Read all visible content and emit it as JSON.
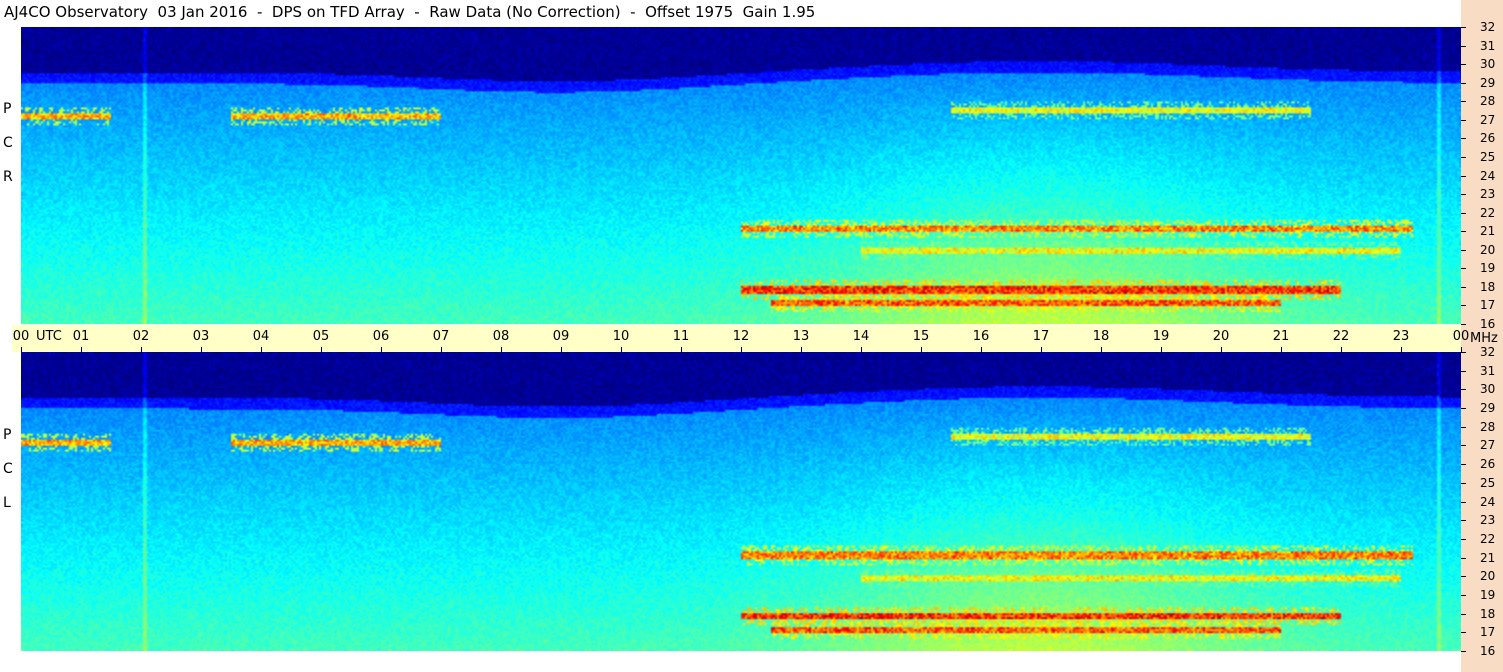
{
  "header": {
    "title": "AJ4CO Observatory  03 Jan 2016  -  DPS on TFD Array  -  Raw Data (No Correction)  -  Offset 1975  Gain 1.95"
  },
  "panels": [
    {
      "id": "rcp",
      "letters": [
        "R",
        "C",
        "P"
      ]
    },
    {
      "id": "lcp",
      "letters": [
        "L",
        "C",
        "P"
      ]
    }
  ],
  "time_axis": {
    "utc_label": "UTC",
    "hour_labels": [
      "00",
      "01",
      "02",
      "03",
      "04",
      "05",
      "06",
      "07",
      "08",
      "09",
      "10",
      "11",
      "12",
      "13",
      "14",
      "15",
      "16",
      "17",
      "18",
      "19",
      "20",
      "21",
      "22",
      "23",
      "00"
    ],
    "unit_label": "MHz"
  },
  "chart_data": {
    "type": "heatmap",
    "title": "AJ4CO Observatory  03 Jan 2016  -  DPS on TFD Array  -  Raw Data (No Correction)  -  Offset 1975  Gain 1.95",
    "x": {
      "label": "UTC",
      "range_hours": [
        0,
        24
      ],
      "tick_labels": [
        "00",
        "01",
        "02",
        "03",
        "04",
        "05",
        "06",
        "07",
        "08",
        "09",
        "10",
        "11",
        "12",
        "13",
        "14",
        "15",
        "16",
        "17",
        "18",
        "19",
        "20",
        "21",
        "22",
        "23",
        "00"
      ]
    },
    "y": {
      "label": "MHz",
      "range": [
        16,
        32
      ],
      "tick_labels": [
        "32",
        "31",
        "30",
        "29",
        "28",
        "27",
        "26",
        "25",
        "24",
        "23",
        "22",
        "21",
        "20",
        "19",
        "18",
        "17",
        "16"
      ]
    },
    "colormap": "jet",
    "colors": {
      "background_low": "#000020",
      "mid": "#0a4ed8",
      "high": "#7ff0c8",
      "peak": "#ff3060"
    },
    "series": [
      {
        "name": "RCP",
        "features": [
          {
            "kind": "dark-band",
            "freq_range": [
              29.6,
              32
            ],
            "time_range": [
              0,
              24
            ]
          },
          {
            "kind": "emission-band",
            "freq": 27.2,
            "time_range": [
              0,
              1.5
            ],
            "intensity": 0.8
          },
          {
            "kind": "emission-band",
            "freq": 27.2,
            "time_range": [
              3.5,
              7
            ],
            "intensity": 0.8
          },
          {
            "kind": "emission-band",
            "freq": 27.5,
            "time_range": [
              15.5,
              21.5
            ],
            "intensity": 0.7
          },
          {
            "kind": "emission-band",
            "freq": 21.1,
            "time_range": [
              12,
              23.2
            ],
            "intensity": 0.85
          },
          {
            "kind": "emission-band",
            "freq": 17.8,
            "time_range": [
              12,
              22
            ],
            "intensity": 0.95
          },
          {
            "kind": "emission-band",
            "freq": 17.1,
            "time_range": [
              12.5,
              21
            ],
            "intensity": 0.9
          },
          {
            "kind": "emission-band",
            "freq": 19.9,
            "time_range": [
              14,
              23
            ],
            "intensity": 0.7
          }
        ]
      },
      {
        "name": "LCP",
        "features": [
          {
            "kind": "dark-band",
            "freq_range": [
              29.6,
              32
            ],
            "time_range": [
              0,
              24
            ]
          },
          {
            "kind": "emission-band",
            "freq": 27.2,
            "time_range": [
              0,
              1.5
            ],
            "intensity": 0.8
          },
          {
            "kind": "emission-band",
            "freq": 27.2,
            "time_range": [
              3.5,
              7
            ],
            "intensity": 0.8
          },
          {
            "kind": "emission-band",
            "freq": 27.5,
            "time_range": [
              15.5,
              21.5
            ],
            "intensity": 0.7
          },
          {
            "kind": "emission-band",
            "freq": 21.1,
            "time_range": [
              12,
              23.2
            ],
            "intensity": 0.85
          },
          {
            "kind": "emission-band",
            "freq": 17.8,
            "time_range": [
              12,
              22
            ],
            "intensity": 0.95
          },
          {
            "kind": "emission-band",
            "freq": 17.1,
            "time_range": [
              12.5,
              21
            ],
            "intensity": 0.9
          },
          {
            "kind": "emission-band",
            "freq": 19.9,
            "time_range": [
              14,
              23
            ],
            "intensity": 0.7
          }
        ]
      }
    ]
  }
}
